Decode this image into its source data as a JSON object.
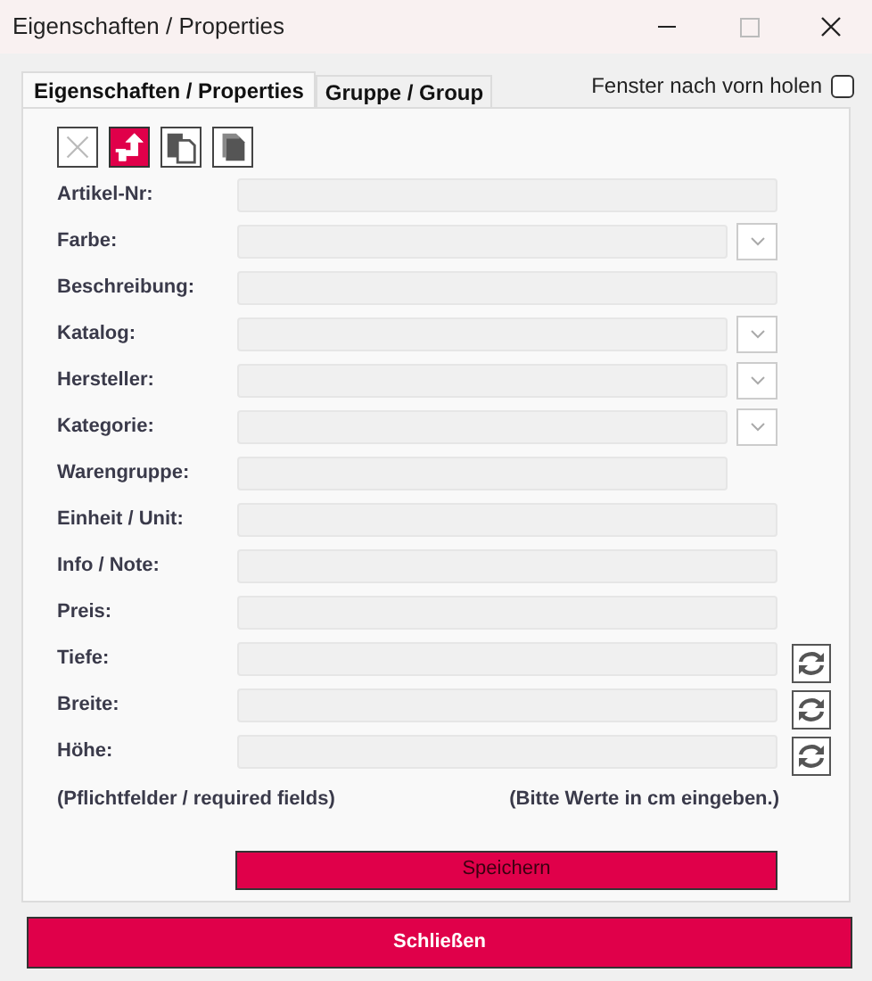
{
  "window": {
    "title": "Eigenschaften / Properties"
  },
  "tabs": [
    {
      "label": "Eigenschaften / Properties",
      "selected": true
    },
    {
      "label": "Gruppe / Group",
      "selected": false
    }
  ],
  "bring_to_front": {
    "label": "Fenster nach vorn holen",
    "checked": false
  },
  "toolbar": [
    {
      "kind": "delete",
      "selected": false
    },
    {
      "kind": "swap",
      "selected": true
    },
    {
      "kind": "copy",
      "selected": false
    },
    {
      "kind": "document",
      "selected": false
    }
  ],
  "fields": [
    {
      "label": "Artikel-Nr:",
      "kind": "text"
    },
    {
      "label": "Farbe:",
      "kind": "combo"
    },
    {
      "label": "Beschreibung:",
      "kind": "text"
    },
    {
      "label": "Katalog:",
      "kind": "combo"
    },
    {
      "label": "Hersteller:",
      "kind": "combo"
    },
    {
      "label": "Kategorie:",
      "kind": "combo"
    },
    {
      "label": "Warengruppe:",
      "kind": "short"
    },
    {
      "label": "Einheit / Unit:",
      "kind": "text"
    },
    {
      "label": "Info / Note:",
      "kind": "text"
    },
    {
      "label": "Preis:",
      "kind": "text"
    },
    {
      "label": "Tiefe:",
      "kind": "refresh"
    },
    {
      "label": "Breite:",
      "kind": "refresh"
    },
    {
      "label": "Höhe:",
      "kind": "refresh"
    }
  ],
  "notes": {
    "required": "(Pflichtfelder / required fields)",
    "units": "(Bitte Werte in cm eingeben.)"
  },
  "save_button": "Speichern",
  "close_button": "Schließen"
}
